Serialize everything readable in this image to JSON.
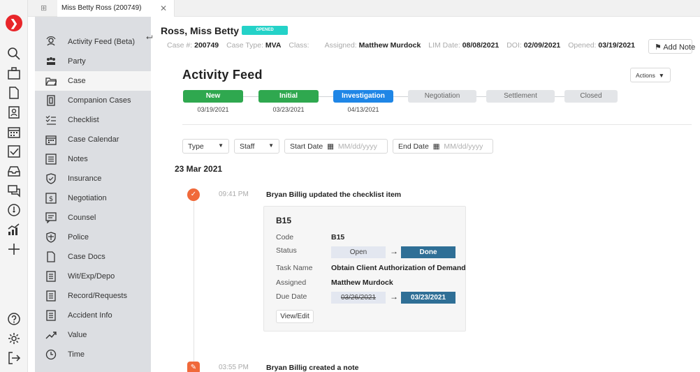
{
  "tabs": [
    {
      "label": "Miss Betty Ross (200749)",
      "close": "✕"
    }
  ],
  "menu": {
    "items": [
      {
        "label": "Activity Feed (Beta)",
        "icon": "activity-feed-icon"
      },
      {
        "label": "Party",
        "icon": "party-icon"
      },
      {
        "label": "Case",
        "icon": "case-folder-icon",
        "active": true
      },
      {
        "label": "Companion Cases",
        "icon": "companion-cases-icon"
      },
      {
        "label": "Checklist",
        "icon": "checklist-icon"
      },
      {
        "label": "Case Calendar",
        "icon": "calendar-icon"
      },
      {
        "label": "Notes",
        "icon": "notes-icon"
      },
      {
        "label": "Insurance",
        "icon": "shield-icon"
      },
      {
        "label": "Negotiation",
        "icon": "dollar-icon"
      },
      {
        "label": "Counsel",
        "icon": "counsel-icon"
      },
      {
        "label": "Police",
        "icon": "police-badge-icon"
      },
      {
        "label": "Case Docs",
        "icon": "document-icon"
      },
      {
        "label": "Wit/Exp/Depo",
        "icon": "list-doc-icon"
      },
      {
        "label": "Record/Requests",
        "icon": "list-doc-icon"
      },
      {
        "label": "Accident Info",
        "icon": "list-doc-icon"
      },
      {
        "label": "Value",
        "icon": "trend-up-icon"
      },
      {
        "label": "Time",
        "icon": "clock-icon"
      }
    ]
  },
  "header": {
    "case_name": "Ross, Miss Betty",
    "status_badge": "OPENED",
    "case_no_label": "Case #:",
    "case_no": "200749",
    "case_type_label": "Case Type:",
    "case_type": "MVA",
    "class_label": "Class:",
    "class_value": "",
    "assigned_label": "Assigned:",
    "assigned": "Matthew Murdock",
    "lim_label": "LIM Date:",
    "lim_date": "08/08/2021",
    "doi_label": "DOI:",
    "doi": "02/09/2021",
    "opened_label": "Opened:",
    "opened": "03/19/2021",
    "add_note": "Add Note"
  },
  "feed": {
    "title": "Activity Feed",
    "actions_label": "Actions",
    "stages": [
      {
        "label": "New",
        "date": "03/19/2021",
        "color": "#2fa84f"
      },
      {
        "label": "Initial",
        "date": "03/23/2021",
        "color": "#2fa84f"
      },
      {
        "label": "Investigation",
        "date": "04/13/2021",
        "color": "#1f86e6"
      },
      {
        "label": "Negotiation",
        "date": ""
      },
      {
        "label": "Settlement",
        "date": ""
      },
      {
        "label": "Closed",
        "date": ""
      }
    ],
    "filters": {
      "type": "Type",
      "staff": "Staff",
      "start_label": "Start Date",
      "start_placeholder": "MM/dd/yyyy",
      "end_label": "End Date",
      "end_placeholder": "MM/dd/yyyy"
    },
    "date_heading": "23 Mar 2021",
    "events": [
      {
        "time": "09:41 PM",
        "text": "Bryan Billig updated the checklist item",
        "card": {
          "title": "B15",
          "code_label": "Code",
          "code": "B15",
          "status_label": "Status",
          "status_old": "Open",
          "status_new": "Done",
          "task_label": "Task Name",
          "task": "Obtain Client Authorization of Demand",
          "assigned_label": "Assigned",
          "assigned": "Matthew Murdock",
          "due_label": "Due Date",
          "due_old": "03/26/2021",
          "due_new": "03/23/2021",
          "view_edit": "View/Edit"
        }
      },
      {
        "time": "03:55 PM",
        "text": "Bryan Billig created a note"
      }
    ]
  }
}
